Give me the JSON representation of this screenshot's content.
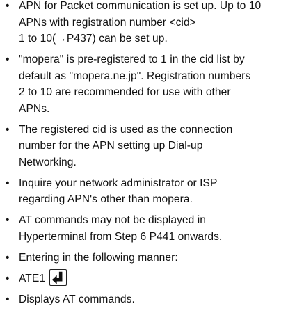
{
  "items": [
    {
      "lines": [
        "APN for Packet communication is set up. Up to 10",
        "APNs with registration number <cid>",
        "1 to 10(→P437) can be set up."
      ]
    },
    {
      "lines": [
        "\"mopera\" is pre-registered to 1 in the cid list by",
        "default as \"mopera.ne.jp\". Registration numbers",
        "2 to 10 are recommended for use with other",
        "APNs."
      ]
    },
    {
      "lines": [
        "The registered cid is used as the connection",
        "number for the APN setting up Dial-up",
        "Networking."
      ]
    },
    {
      "lines": [
        "Inquire your network administrator or ISP",
        "regarding APN's other than mopera."
      ]
    },
    {
      "lines": [
        "AT commands may not be displayed in",
        "Hyperterminal from Step 6 P441 onwards."
      ]
    },
    {
      "lines": [
        "Entering in the following manner:"
      ]
    },
    {
      "lines": [
        "ATE1"
      ],
      "icon": "enter-key-icon"
    },
    {
      "lines": [
        "Displays AT commands."
      ]
    }
  ],
  "bullet_char": "•"
}
